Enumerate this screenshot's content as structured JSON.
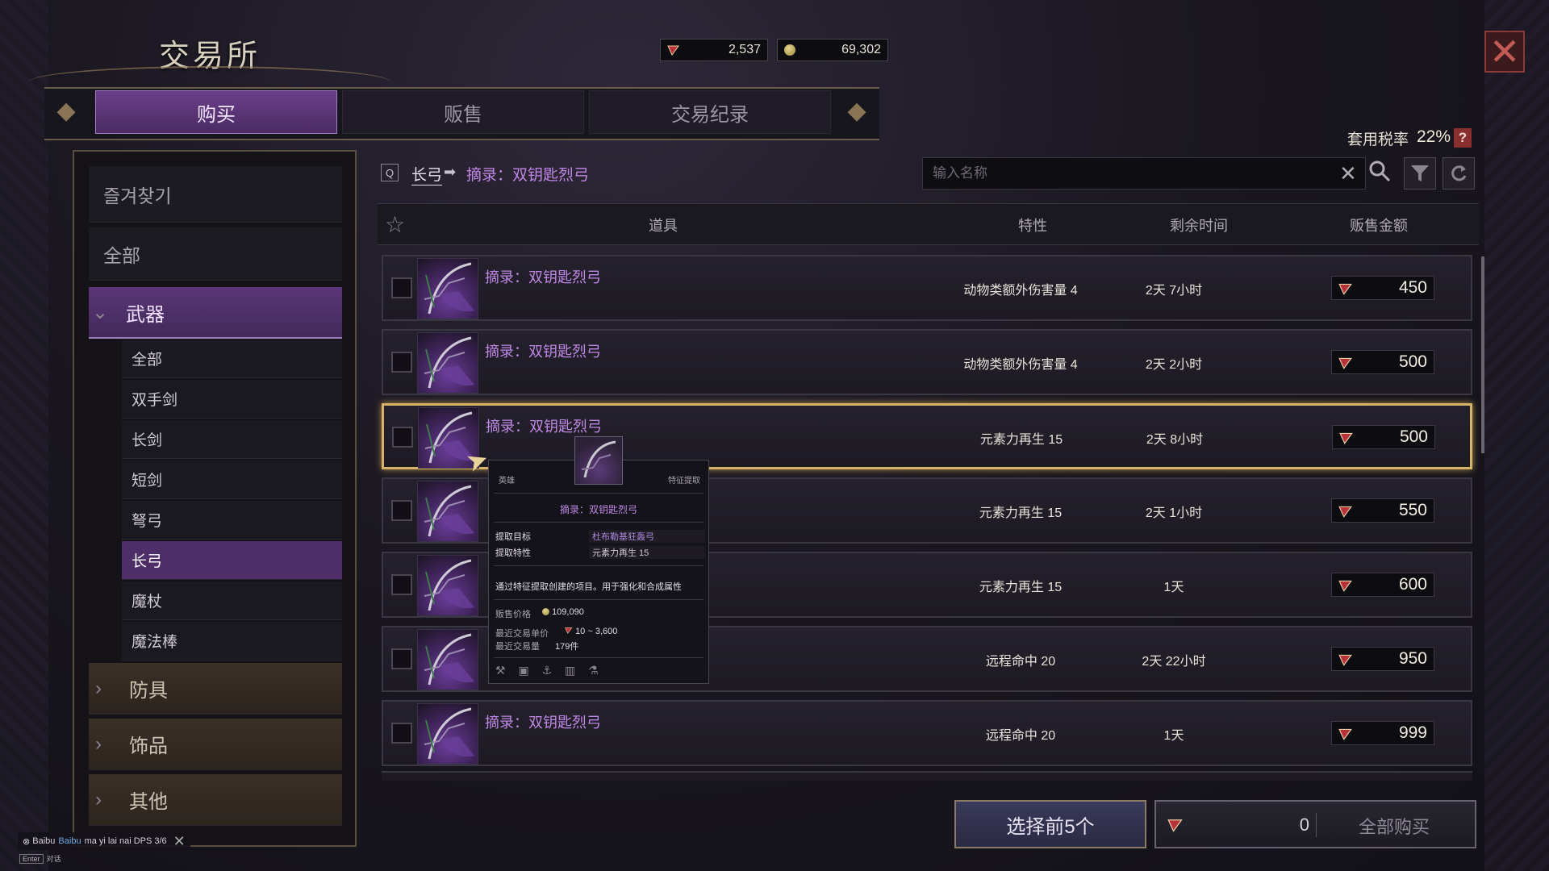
{
  "title": "交易所",
  "currency": {
    "gems": "2,537",
    "gold": "69,302"
  },
  "tabs": [
    {
      "label": "购买",
      "active": true
    },
    {
      "label": "贩售",
      "active": false
    },
    {
      "label": "交易纪录",
      "active": false
    }
  ],
  "tax": {
    "label": "套用税率",
    "value": "22%",
    "help": "?"
  },
  "sidebar": {
    "favorites": "즐겨찾기",
    "all": "全部",
    "weapons": "武器",
    "sub_items": [
      "全部",
      "双手剑",
      "长剑",
      "短剑",
      "弩弓",
      "长弓",
      "魔杖",
      "魔法棒"
    ],
    "active_sub": "长弓",
    "armor": "防具",
    "accessories": "饰品",
    "other": "其他"
  },
  "breadcrumb": {
    "key": "Q",
    "category": "长弓",
    "arrow": "➡",
    "item": "摘录：双钥匙烈弓"
  },
  "search": {
    "placeholder": "输入名称",
    "value": ""
  },
  "table": {
    "headers": [
      "道具",
      "特性",
      "剩余时间",
      "贩售金额"
    ],
    "rows": [
      {
        "name": "摘录：双钥匙烈弓",
        "trait": "动物类额外伤害量 4",
        "time": "2天 7小时",
        "price": "450"
      },
      {
        "name": "摘录：双钥匙烈弓",
        "trait": "动物类额外伤害量 4",
        "time": "2天 2小时",
        "price": "500"
      },
      {
        "name": "摘录：双钥匙烈弓",
        "trait": "元素力再生 15",
        "time": "2天 8小时",
        "price": "500",
        "highlight": true
      },
      {
        "name": "",
        "trait": "元素力再生 15",
        "time": "2天 1小时",
        "price": "550"
      },
      {
        "name": "",
        "trait": "元素力再生 15",
        "time": "1天",
        "price": "600"
      },
      {
        "name": "",
        "trait": "远程命中 20",
        "time": "2天 22小时",
        "price": "950"
      },
      {
        "name": "摘录：双钥匙烈弓",
        "trait": "远程命中 20",
        "time": "1天",
        "price": "999"
      }
    ]
  },
  "tooltip": {
    "rarity": "英雄",
    "kind": "特征提取",
    "title": "摘录：双钥匙烈弓",
    "target_label": "提取目标",
    "target_value": "杜布勒基狂轰弓",
    "trait_label": "提取特性",
    "trait_value": "元素力再生 15",
    "description": "通过特征提取创建的项目。用于强化和合成属性",
    "sell_price_label": "贩售价格",
    "sell_price": "109,090",
    "recent_unit_label": "最近交易单价",
    "recent_unit": "10 ~ 3,600",
    "recent_volume_label": "最近交易量",
    "recent_volume": "179件"
  },
  "bottom": {
    "select_label": "选择前5个",
    "total": "0",
    "buy_all_label": "全部购买"
  },
  "chat": {
    "sender": "Baibu",
    "name": "Baibu",
    "message": "ma yi lai nai DPS 3/6",
    "hint_key": "Enter",
    "hint_label": "对话"
  },
  "colors": {
    "accent_purple": "#5a3578",
    "item_name": "#c088e6",
    "highlight_border": "#d6b36b",
    "close_red": "#8a3a38"
  },
  "icons": [
    "gem-icon",
    "gold-coin-icon",
    "close-icon",
    "help-icon",
    "star-icon",
    "search-icon",
    "clear-icon",
    "filter-icon",
    "refresh-icon",
    "chevron-down-icon",
    "chevron-right-icon"
  ]
}
